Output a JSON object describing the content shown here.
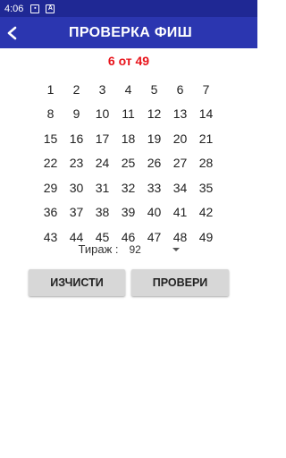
{
  "status": {
    "time": "4:06",
    "icons": [
      "image-icon",
      "a-icon"
    ]
  },
  "appbar": {
    "title": "ПРОВЕРКА ФИШ",
    "back_icon": "arrow-left-icon"
  },
  "selection_count": "6 от 49",
  "numbers": [
    [
      "1",
      "2",
      "3",
      "4",
      "5",
      "6",
      "7"
    ],
    [
      "8",
      "9",
      "10",
      "11",
      "12",
      "13",
      "14"
    ],
    [
      "15",
      "16",
      "17",
      "18",
      "19",
      "20",
      "21"
    ],
    [
      "22",
      "23",
      "24",
      "25",
      "26",
      "27",
      "28"
    ],
    [
      "29",
      "30",
      "31",
      "32",
      "33",
      "34",
      "35"
    ],
    [
      "36",
      "37",
      "38",
      "39",
      "40",
      "41",
      "42"
    ],
    [
      "43",
      "44",
      "45",
      "46",
      "47",
      "48",
      "49"
    ]
  ],
  "draw": {
    "label": "Тираж :",
    "selected": "92"
  },
  "buttons": {
    "clear": "ИЗЧИСТИ",
    "check": "ПРОВЕРИ"
  },
  "colors": {
    "status_bar": "#1f2894",
    "app_bar": "#2b36b0",
    "count_text": "#e8141b",
    "button_bg": "#d7d7d7"
  }
}
